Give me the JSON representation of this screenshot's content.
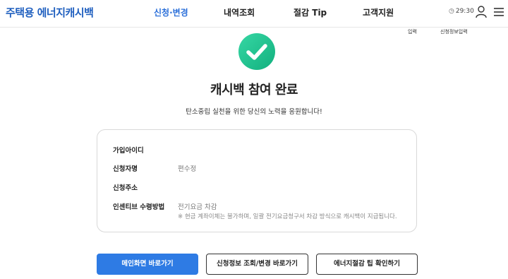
{
  "header": {
    "logo": "주택용 에너지캐시백",
    "nav": [
      "신청·변경",
      "내역조회",
      "절감 Tip",
      "고객지원"
    ],
    "timer": "29:30",
    "icons": {
      "clock": "clock-icon",
      "user": "user-icon",
      "menu": "menu-icon"
    }
  },
  "subnav": {
    "item1": "입력",
    "item2": "신청정보입력"
  },
  "main": {
    "title": "캐시백 참여 완료",
    "subtitle": "탄소중립 실천을 위한 당신의 노력을 응원합니다!"
  },
  "info": {
    "rows": [
      {
        "label": "가입아이디",
        "value": ""
      },
      {
        "label": "신청자명",
        "value": "편수정"
      },
      {
        "label": "신청주소",
        "value": ""
      },
      {
        "label": "인센티브 수령방법",
        "value": "전기요금 차감",
        "note": "※ 현금 계좌이체는 불가하며, 일괄 전기요금청구서 차감 방식으로 캐시백이 지급됩니다."
      }
    ]
  },
  "buttons": {
    "main": "메인화면 바로가기",
    "lookup": "신청정보 조회/변경 바로가기",
    "tip": "에너지절감 팁 확인하기"
  },
  "colors": {
    "accent": "#2e7be4",
    "check": "#1fc48f",
    "logo": "#1f5fbf"
  }
}
